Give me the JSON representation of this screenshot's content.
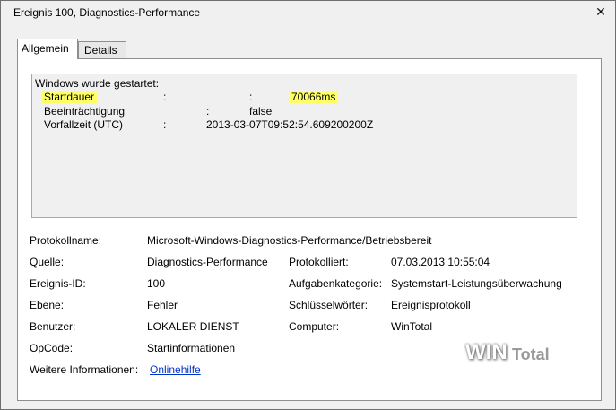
{
  "window": {
    "title": "Ereignis 100, Diagnostics-Performance",
    "close_glyph": "✕"
  },
  "tabs": [
    {
      "label": "Allgemein",
      "active": true
    },
    {
      "label": "Details",
      "active": false
    }
  ],
  "description": {
    "header": "Windows wurde gestartet:",
    "rows": [
      {
        "label": "Startdauer",
        "sep1": ":",
        "sep2": ":",
        "value": "70066ms",
        "highlighted": true
      },
      {
        "label": "Beeinträchtigung",
        "sep1": ":",
        "value": "false"
      },
      {
        "label": "Vorfallzeit (UTC)",
        "sep1": ":",
        "value": "2013-03-07T09:52:54.609200200Z"
      }
    ],
    "highlight_color": "#ffff66"
  },
  "fields": {
    "log_name": {
      "label": "Protokollname:",
      "value": "Microsoft-Windows-Diagnostics-Performance/Betriebsbereit"
    },
    "source": {
      "label": "Quelle:",
      "value": "Diagnostics-Performance"
    },
    "logged": {
      "label": "Protokolliert:",
      "value": "07.03.2013 10:55:04"
    },
    "event_id": {
      "label": "Ereignis-ID:",
      "value": "100"
    },
    "task_category": {
      "label": "Aufgabenkategorie:",
      "value": "Systemstart-Leistungsüberwachung"
    },
    "level": {
      "label": "Ebene:",
      "value": "Fehler"
    },
    "keywords": {
      "label": "Schlüsselwörter:",
      "value": "Ereignisprotokoll"
    },
    "user": {
      "label": "Benutzer:",
      "value": "LOKALER DIENST"
    },
    "computer": {
      "label": "Computer:",
      "value": "WinTotal"
    },
    "opcode": {
      "label": "OpCode:",
      "value": "Startinformationen"
    },
    "more_info": {
      "label": "Weitere Informationen:",
      "value": "Onlinehilfe"
    }
  },
  "watermark": {
    "part1": "WIN",
    "part2": "Total"
  },
  "colors": {
    "link": "#0033cc",
    "window_bg": "#f0f0f0"
  }
}
